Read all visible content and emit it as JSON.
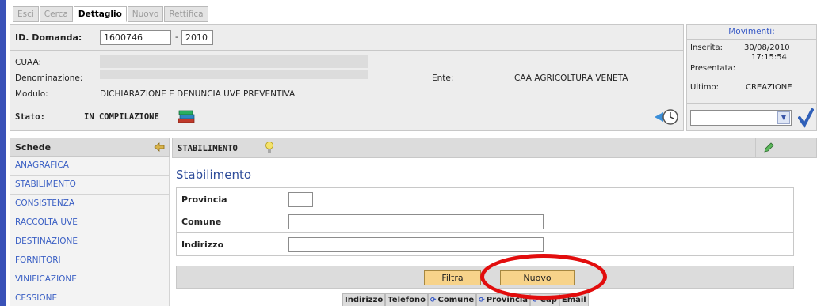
{
  "tabs": [
    {
      "label": "Esci",
      "active": false
    },
    {
      "label": "Cerca",
      "active": false
    },
    {
      "label": "Dettaglio",
      "active": true
    },
    {
      "label": "Nuovo",
      "active": false
    },
    {
      "label": "Rettifica",
      "active": false
    }
  ],
  "header": {
    "id_domanda_label": "ID. Domanda:",
    "id_domanda_value": "1600746",
    "separator": "-",
    "anno_value": "2010",
    "cuaa_label": "CUAA:",
    "denominazione_label": "Denominazione:",
    "modulo_label": "Modulo:",
    "modulo_value": "DICHIARAZIONE E DENUNCIA UVE PREVENTIVA",
    "ente_label": "Ente:",
    "ente_value": "CAA AGRICOLTURA VENETA",
    "stato_label": "Stato:",
    "stato_value": "IN COMPILAZIONE"
  },
  "movimenti": {
    "title": "Movimenti:",
    "inserita_label": "Inserita:",
    "inserita_date": "30/08/2010",
    "inserita_time": "17:15:54",
    "presentata_label": "Presentata:",
    "ultimo_label": "Ultimo:",
    "ultimo_value": "CREAZIONE",
    "select_value": ""
  },
  "sidebar": {
    "title": "Schede",
    "items": [
      "ANAGRAFICA",
      "STABILIMENTO",
      "CONSISTENZA",
      "RACCOLTA UVE",
      "DESTINAZIONE",
      "FORNITORI",
      "VINIFICAZIONE",
      "CESSIONE"
    ]
  },
  "content": {
    "bar_title": "STABILIMENTO",
    "title": "Stabilimento",
    "fields": [
      {
        "label": "Provincia",
        "value": ""
      },
      {
        "label": "Comune",
        "value": ""
      },
      {
        "label": "Indirizzo",
        "value": ""
      }
    ],
    "filtra_label": "Filtra",
    "nuovo_label": "Nuovo",
    "columns": [
      {
        "label": "Indirizzo",
        "sortable": false
      },
      {
        "label": "Telefono",
        "sortable": false
      },
      {
        "label": "Comune",
        "sortable": true
      },
      {
        "label": "Provincia",
        "sortable": true
      },
      {
        "label": "Cap",
        "sortable": true
      },
      {
        "label": "Email",
        "sortable": false
      }
    ],
    "sort_glyph": "⟳"
  },
  "colors": {
    "accent_blue": "#3457c6",
    "button_orange": "#f7d38a",
    "highlight_red": "#e20d0d"
  }
}
